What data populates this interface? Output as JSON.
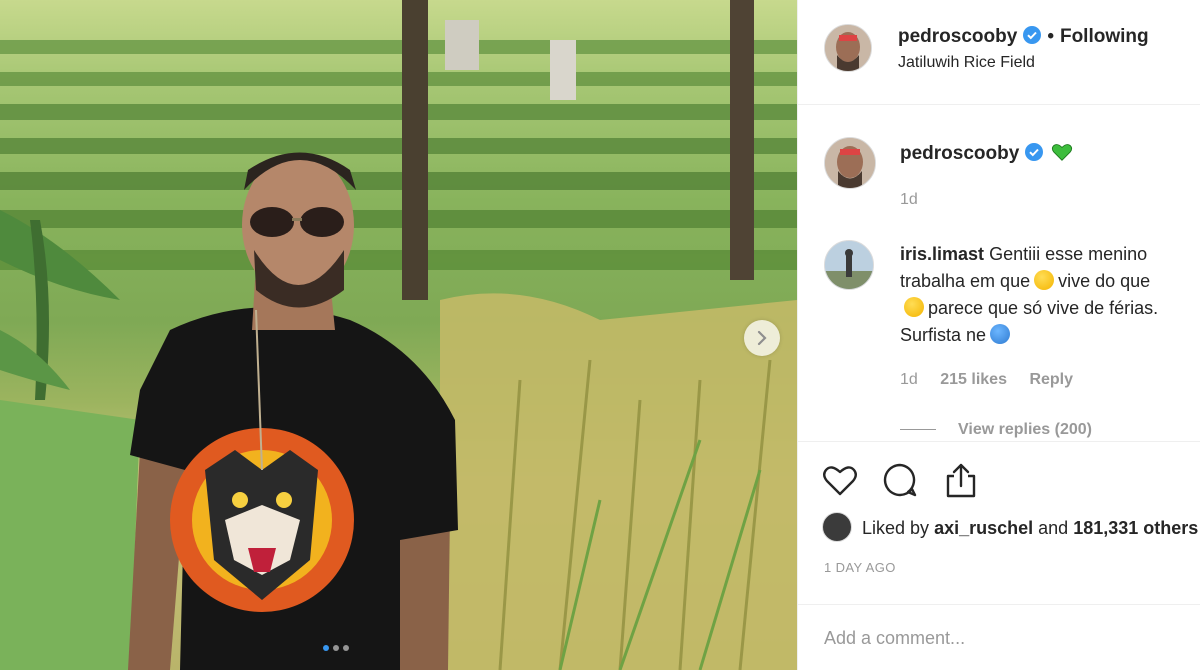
{
  "post": {
    "username": "pedroscooby",
    "follow_state": "Following",
    "location": "Jatiluwih Rice Field",
    "caption_time": "1d",
    "carousel": {
      "slide_count": 3,
      "active_index": 0
    }
  },
  "comment": {
    "username": "iris.limast",
    "text_1": "Gentiii esse menino",
    "text_2a": "trabalha em que",
    "text_2b": "vive do que",
    "text_3": "parece que só vive de férias.",
    "text_4": "Surfista ne",
    "time": "1d",
    "likes": "215 likes",
    "reply": "Reply",
    "view_replies": "View replies (200)"
  },
  "engagement": {
    "liked_by_prefix": "Liked by",
    "liked_by_user": "axi_ruschel",
    "liked_by_and": "and",
    "liked_by_count": "181,331 others",
    "date": "1 DAY AGO"
  },
  "add_comment": {
    "placeholder": "Add a comment..."
  },
  "icons": {
    "verified": "verified-badge-icon",
    "green_heart": "green-heart-emoji-icon",
    "like": "heart-outline-icon",
    "comment": "comment-bubble-icon",
    "share": "share-icon",
    "next": "chevron-right-icon"
  },
  "colors": {
    "verified": "#3897f0",
    "muted": "#999999",
    "text": "#262626",
    "green_heart": "#3dbd3d"
  }
}
